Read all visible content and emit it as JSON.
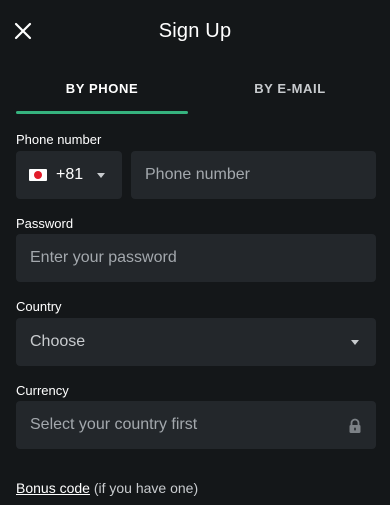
{
  "header": {
    "title": "Sign Up",
    "close_icon": "close-icon"
  },
  "tabs": [
    {
      "label": "BY PHONE",
      "active": true
    },
    {
      "label": "BY E-MAIL",
      "active": false
    }
  ],
  "phone_section": {
    "label": "Phone number",
    "country_code": "+81",
    "flag": "japan-flag-icon",
    "placeholder": "Phone number"
  },
  "password_section": {
    "label": "Password",
    "placeholder": "Enter your password"
  },
  "country_section": {
    "label": "Country",
    "selected": "Choose"
  },
  "currency_section": {
    "label": "Currency",
    "placeholder": "Select your country first",
    "lock_icon": "lock-icon"
  },
  "bonus": {
    "link_text": "Bonus code",
    "suffix": " (if you have one)"
  },
  "colors": {
    "background": "#141719",
    "field_background": "#23272b",
    "accent": "#36b37e"
  }
}
